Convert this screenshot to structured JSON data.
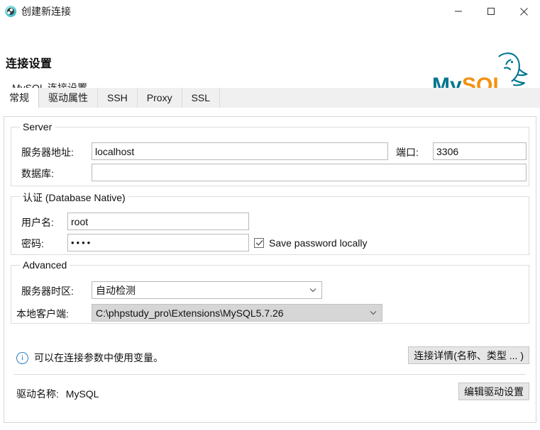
{
  "window": {
    "title": "创建新连接",
    "icon": "globe-icon",
    "controls": {
      "minimize": "minimize-icon",
      "maximize": "maximize-icon",
      "close": "close-icon"
    }
  },
  "header": {
    "title": "连接设置",
    "subtitle": "MySQL 连接设置",
    "logo_alt": "mysql-logo",
    "logo_text": "MySQL",
    "logo_colors": {
      "teal": "#00758f",
      "orange": "#f29111"
    }
  },
  "tabs": [
    {
      "label": "常规",
      "active": true
    },
    {
      "label": "驱动属性",
      "active": false
    },
    {
      "label": "SSH",
      "active": false
    },
    {
      "label": "Proxy",
      "active": false
    },
    {
      "label": "SSL",
      "active": false
    }
  ],
  "groups": {
    "server": {
      "title": "Server",
      "host_label": "服务器地址:",
      "host_value": "localhost",
      "host_placeholder": "",
      "port_label": "端口:",
      "port_value": "3306",
      "db_label": "数据库:",
      "db_value": "",
      "db_placeholder": ""
    },
    "auth": {
      "title": "认证 (Database Native)",
      "user_label": "用户名:",
      "user_value": "root",
      "password_label": "密码:",
      "password_value": "••••",
      "save_password_label": "Save password locally",
      "save_password_checked": true
    },
    "advanced": {
      "title": "Advanced",
      "timezone_label": "服务器时区:",
      "timezone_value": "自动检测",
      "local_client_label": "本地客户端:",
      "local_client_value": "C:\\phpstudy_pro\\Extensions\\MySQL5.7.26"
    }
  },
  "footer": {
    "hint_icon": "info-icon",
    "hint_text": "可以在连接参数中使用变量。",
    "connection_details_button": "连接详情(名称、类型 ... )",
    "driver_name_label": "驱动名称:",
    "driver_name_value": "MySQL",
    "edit_driver_button": "编辑驱动设置"
  }
}
